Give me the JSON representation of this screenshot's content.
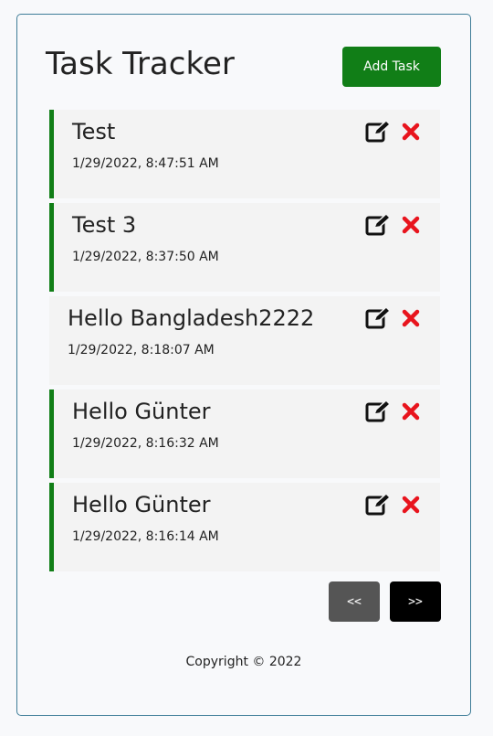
{
  "header": {
    "title": "Task Tracker",
    "add_label": "Add Task"
  },
  "tasks": [
    {
      "text": "Test",
      "date": "1/29/2022, 8:47:51 AM",
      "reminder": true
    },
    {
      "text": "Test 3",
      "date": "1/29/2022, 8:37:50 AM",
      "reminder": true
    },
    {
      "text": "Hello Bangladesh2222",
      "date": "1/29/2022, 8:18:07 AM",
      "reminder": false
    },
    {
      "text": "Hello Günter",
      "date": "1/29/2022, 8:16:32 AM",
      "reminder": true
    },
    {
      "text": "Hello Günter",
      "date": "1/29/2022, 8:16:14 AM",
      "reminder": true
    }
  ],
  "icons": {
    "edit": "edit-icon",
    "delete": "close-icon"
  },
  "pagination": {
    "prev_label": "<<",
    "next_label": ">>"
  },
  "footer": {
    "copyright": "Copyright © 2022"
  },
  "colors": {
    "accent": "#117e17",
    "delete": "#e8141d",
    "border": "#3f7d98"
  }
}
